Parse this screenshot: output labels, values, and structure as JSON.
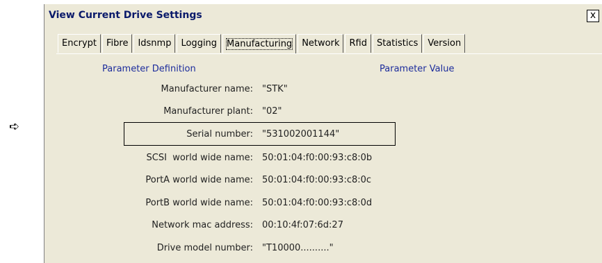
{
  "pointer_glyph": "➪",
  "window": {
    "title": "View Current Drive Settings",
    "close_label": "x"
  },
  "tabs": [
    {
      "label": "Encrypt",
      "active": false
    },
    {
      "label": "Fibre",
      "active": false
    },
    {
      "label": "Idsnmp",
      "active": false
    },
    {
      "label": "Logging",
      "active": false
    },
    {
      "label": "Manufacturing",
      "active": true
    },
    {
      "label": "Network",
      "active": false
    },
    {
      "label": "Rfid",
      "active": false
    },
    {
      "label": "Statistics",
      "active": false
    },
    {
      "label": "Version",
      "active": false
    }
  ],
  "headers": {
    "definition": "Parameter Definition",
    "value": "Parameter Value"
  },
  "rows": [
    {
      "label": "Manufacturer name:",
      "value": "\"STK\""
    },
    {
      "label": "Manufacturer plant:",
      "value": "\"02\""
    },
    {
      "label": "Serial number:",
      "value": "\"531002001144\"",
      "highlighted": true
    },
    {
      "label": "SCSI  world wide name:",
      "value": "50:01:04:f0:00:93:c8:0b"
    },
    {
      "label": "PortA world wide name:",
      "value": "50:01:04:f0:00:93:c8:0c"
    },
    {
      "label": "PortB world wide name:",
      "value": "50:01:04:f0:00:93:c8:0d"
    },
    {
      "label": "Network mac address:",
      "value": "00:10:4f:07:6d:27"
    },
    {
      "label": "Drive model number:",
      "value": "\"T10000..........\""
    }
  ]
}
